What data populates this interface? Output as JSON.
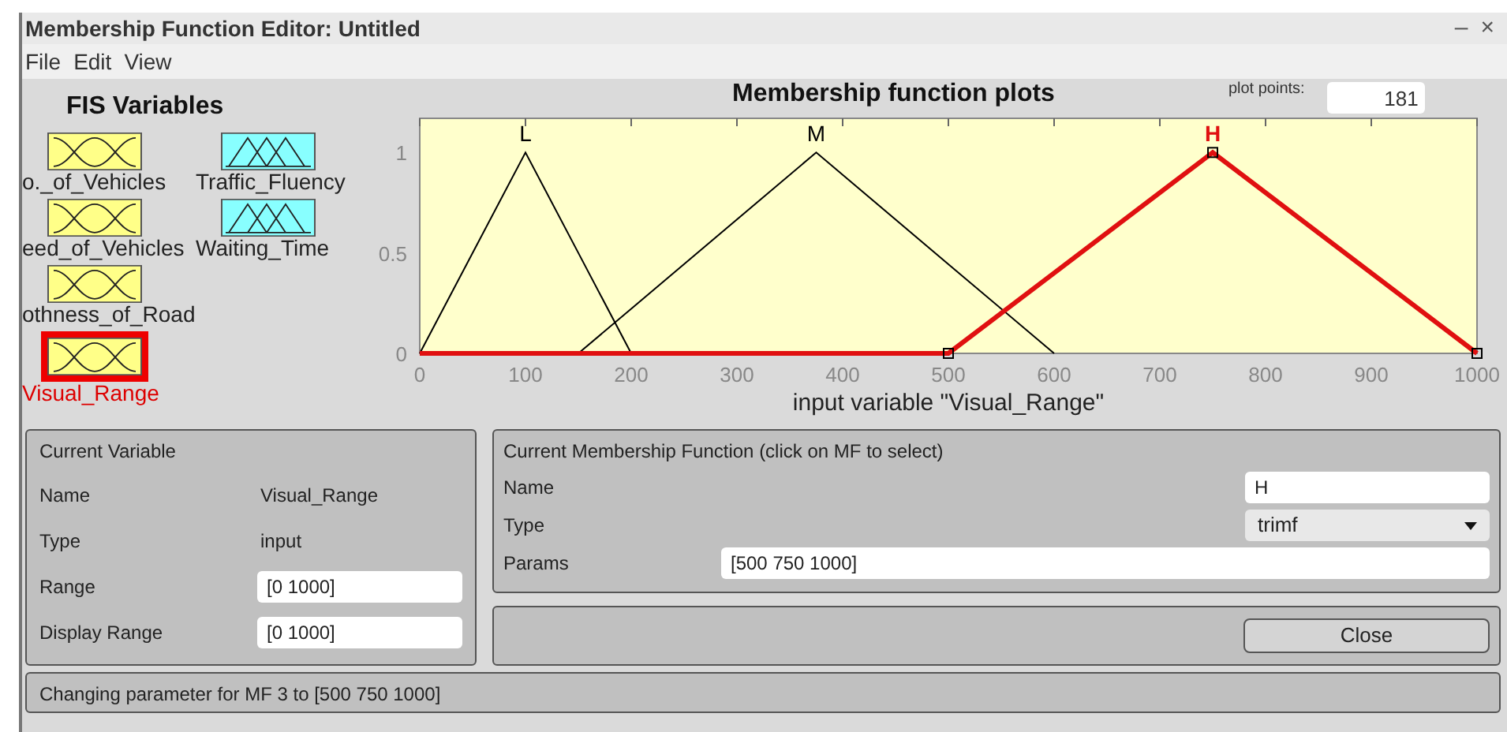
{
  "window": {
    "title": "Membership Function Editor: Untitled",
    "controls": [
      "–",
      "×"
    ]
  },
  "menu": [
    "File",
    "Edit",
    "View"
  ],
  "fis_variables": {
    "title": "FIS Variables",
    "items": [
      {
        "name": "o._of_Vehicles",
        "kind": "input",
        "selected": false
      },
      {
        "name": "Traffic_Fluency",
        "kind": "output",
        "selected": false
      },
      {
        "name": "eed_of_Vehicles",
        "kind": "input",
        "selected": false
      },
      {
        "name": "Waiting_Time",
        "kind": "output",
        "selected": false
      },
      {
        "name": "othness_of_Road",
        "kind": "input",
        "selected": false
      },
      {
        "name": "Visual_Range",
        "kind": "input",
        "selected": true
      }
    ]
  },
  "plot": {
    "title": "Membership function plots",
    "plot_points_label": "plot points:",
    "plot_points": "181",
    "chart_data": {
      "type": "line",
      "xlabel": "input variable \"Visual_Range\"",
      "x": [
        0,
        100,
        150,
        200,
        375,
        500,
        600,
        750,
        1000
      ],
      "xlim": [
        0,
        1000
      ],
      "ylim": [
        0,
        1.17
      ],
      "xticks": [
        0,
        100,
        200,
        300,
        400,
        500,
        600,
        700,
        800,
        900,
        1000
      ],
      "yticks": [
        0,
        0.5,
        1
      ],
      "series": [
        {
          "name": "L",
          "color": "#000000",
          "values": [
            0,
            1,
            0.5,
            0,
            null,
            null,
            null,
            null,
            null
          ]
        },
        {
          "name": "M",
          "color": "#000000",
          "values": [
            null,
            null,
            0,
            0.222,
            1,
            0.444,
            0,
            null,
            null
          ]
        },
        {
          "name": "H",
          "color": "#e01010",
          "values": [
            0,
            0,
            0,
            0,
            0,
            0,
            0.4,
            1,
            0
          ]
        }
      ]
    }
  },
  "current_variable": {
    "title": "Current Variable",
    "rows": [
      {
        "label": "Name",
        "value": "Visual_Range",
        "kind": "text"
      },
      {
        "label": "Type",
        "value": "input",
        "kind": "text"
      },
      {
        "label": "Range",
        "value": "[0 1000]",
        "kind": "field"
      },
      {
        "label": "Display Range",
        "value": "[0 1000]",
        "kind": "field"
      }
    ]
  },
  "current_mf": {
    "title": "Current Membership Function (click on MF to select)",
    "name_label": "Name",
    "name": "H",
    "type_label": "Type",
    "type": "trimf",
    "params_label": "Params",
    "params": "[500 750 1000]"
  },
  "close_button": "Close",
  "status": "Changing parameter for MF 3 to [500 750 1000]"
}
